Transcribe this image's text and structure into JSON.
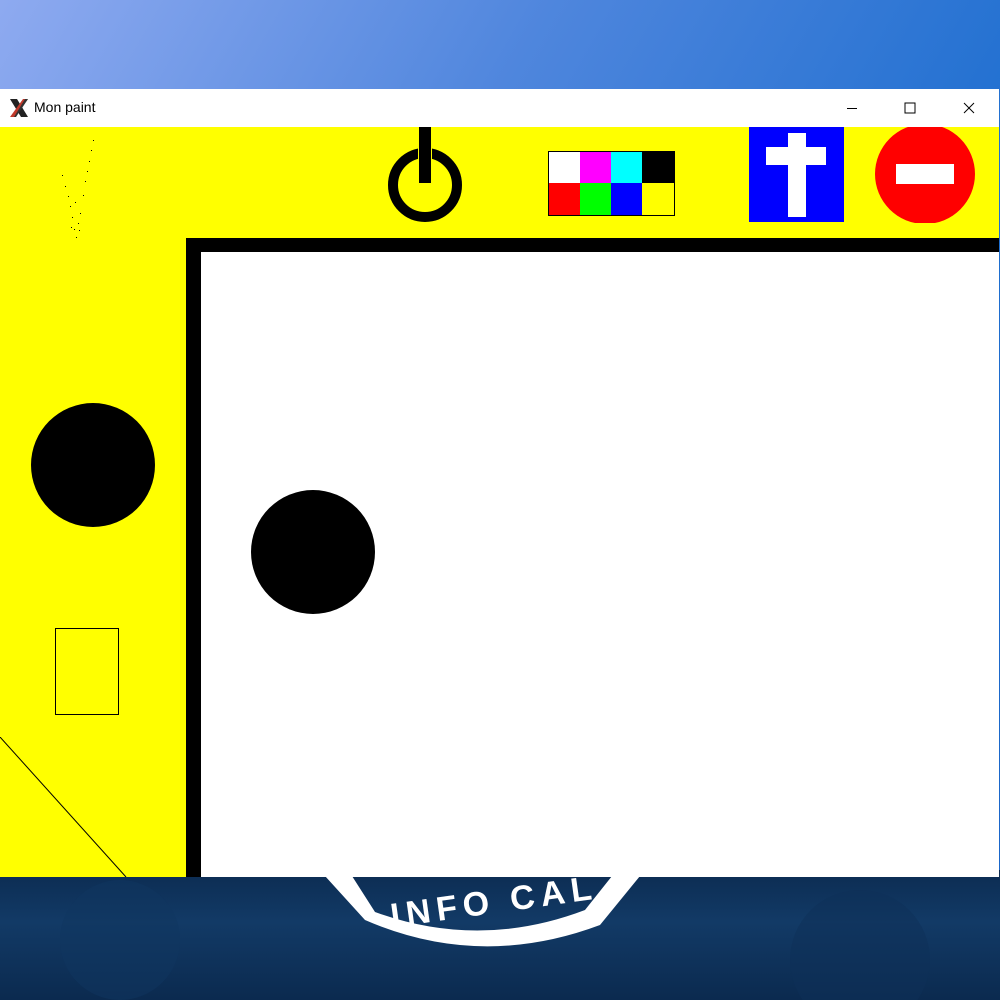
{
  "window": {
    "title": "Mon paint",
    "controls": {
      "minimize": "minimize",
      "maximize": "maximize",
      "close": "close"
    }
  },
  "toolbar": {
    "tools": [
      {
        "name": "power-icon",
        "color": "#000000"
      },
      {
        "name": "palette",
        "colors": [
          "#ffffff",
          "#ff00ff",
          "#00ffff",
          "#000000",
          "#ff0000",
          "#00ff00",
          "#0000ff",
          "#ffff00"
        ]
      },
      {
        "name": "cross-icon",
        "background": "#0000ff",
        "foreground": "#ffffff"
      },
      {
        "name": "no-entry-icon",
        "background": "#ff0000",
        "foreground": "#ffffff"
      }
    ]
  },
  "side_tools": [
    {
      "name": "spray-tool-icon"
    },
    {
      "name": "circle-tool-icon"
    },
    {
      "name": "rectangle-tool-icon"
    },
    {
      "name": "line-tool-icon"
    }
  ],
  "canvas": {
    "background": "#ffffff",
    "shapes": [
      {
        "type": "filled-circle",
        "color": "#000000"
      }
    ]
  },
  "colors": {
    "toolbar_bg": "#ffff00",
    "canvas_border": "#000000"
  },
  "wallpaper": {
    "logo_text": "INFO CAL"
  }
}
